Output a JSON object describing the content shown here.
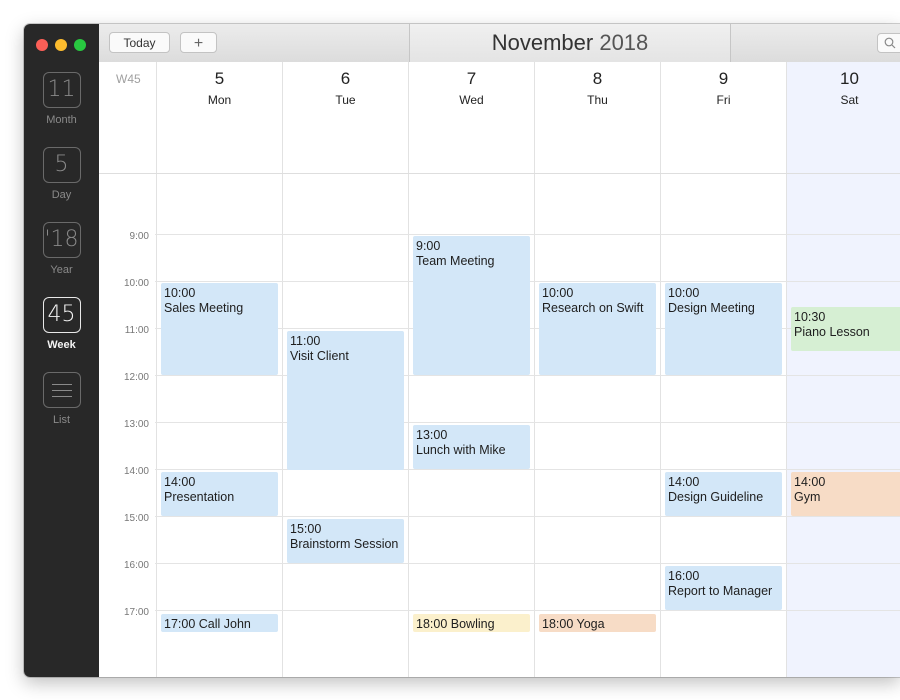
{
  "toolbar": {
    "today_label": "Today",
    "add_label": "+",
    "month": "November",
    "year": "2018"
  },
  "sidebar": {
    "views": [
      {
        "value": "11",
        "label": "Month"
      },
      {
        "value": "5",
        "label": "Day"
      },
      {
        "value": "'18",
        "label": "Year"
      },
      {
        "value": "45",
        "label": "Week"
      },
      {
        "value": "",
        "label": "List"
      }
    ],
    "active_view": "Week"
  },
  "week": {
    "number": "W45",
    "days": [
      {
        "num": "5",
        "name": "Mon"
      },
      {
        "num": "6",
        "name": "Tue"
      },
      {
        "num": "7",
        "name": "Wed"
      },
      {
        "num": "8",
        "name": "Thu"
      },
      {
        "num": "9",
        "name": "Fri"
      },
      {
        "num": "10",
        "name": "Sat"
      }
    ]
  },
  "times": [
    "9:00",
    "10:00",
    "11:00",
    "12:00",
    "13:00",
    "14:00",
    "15:00",
    "16:00",
    "17:00"
  ],
  "events": [
    {
      "time": "10:00",
      "title": "Sales Meeting",
      "day": "Mon",
      "color": "#d3e7f8"
    },
    {
      "time": "14:00",
      "title": "Presentation",
      "day": "Mon",
      "color": "#d3e7f8"
    },
    {
      "time": "17:00",
      "title": "Call John",
      "day": "Mon",
      "color": "#d3e7f8"
    },
    {
      "time": "11:00",
      "title": "Visit Client",
      "day": "Tue",
      "color": "#d3e7f8"
    },
    {
      "time": "15:00",
      "title": "Brainstorm Session",
      "day": "Tue",
      "color": "#d3e7f8"
    },
    {
      "time": "9:00",
      "title": "Team Meeting",
      "day": "Wed",
      "color": "#d3e7f8"
    },
    {
      "time": "13:00",
      "title": "Lunch with Mike",
      "day": "Wed",
      "color": "#d3e7f8"
    },
    {
      "time": "18:00",
      "title": "Bowling",
      "day": "Wed",
      "color": "#fbf0cc"
    },
    {
      "time": "10:00",
      "title": "Research on Swift",
      "day": "Thu",
      "color": "#d3e7f8"
    },
    {
      "time": "18:00",
      "title": "Yoga",
      "day": "Thu",
      "color": "#f7dcc6"
    },
    {
      "time": "10:00",
      "title": "Design Meeting",
      "day": "Fri",
      "color": "#d3e7f8"
    },
    {
      "time": "14:00",
      "title": "Design Guideline",
      "day": "Fri",
      "color": "#d3e7f8"
    },
    {
      "time": "16:00",
      "title": "Report to Manager",
      "day": "Fri",
      "color": "#d3e7f8"
    },
    {
      "time": "10:30",
      "title": "Piano Lesson",
      "day": "Sat",
      "color": "#d6efd3"
    },
    {
      "time": "14:00",
      "title": "Gym",
      "day": "Sat",
      "color": "#f7dcc6"
    }
  ]
}
